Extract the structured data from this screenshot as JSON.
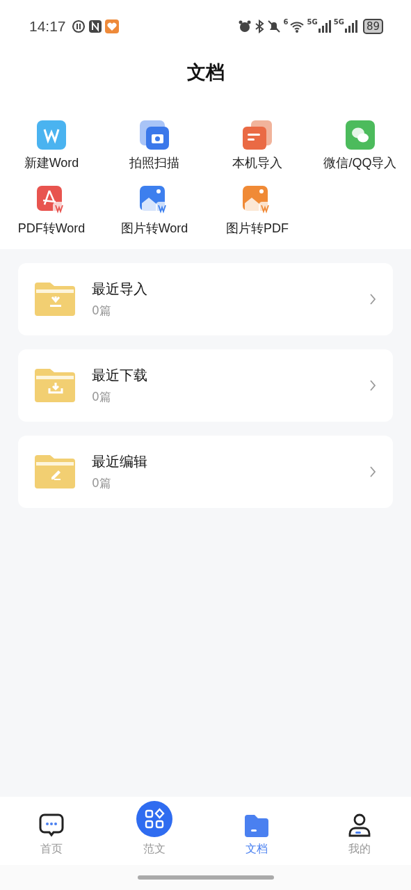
{
  "status_bar": {
    "time": "14:17",
    "wifi_label": "6",
    "networks": [
      "5G",
      "5G"
    ],
    "battery": "89"
  },
  "title": "文档",
  "tools": [
    {
      "label": "新建Word",
      "kind": "word"
    },
    {
      "label": "拍照扫描",
      "kind": "camera"
    },
    {
      "label": "本机导入",
      "kind": "local"
    },
    {
      "label": "微信/QQ导入",
      "kind": "wechat"
    },
    {
      "label": "PDF转Word",
      "kind": "pdf2word"
    },
    {
      "label": "图片转Word",
      "kind": "img2word"
    },
    {
      "label": "图片转PDF",
      "kind": "img2pdf"
    }
  ],
  "folders": [
    {
      "name": "最近导入",
      "count": "0篇",
      "kind": "import"
    },
    {
      "name": "最近下载",
      "count": "0篇",
      "kind": "download"
    },
    {
      "name": "最近编辑",
      "count": "0篇",
      "kind": "edit"
    }
  ],
  "tabs": [
    {
      "label": "首页",
      "kind": "home",
      "selected": false
    },
    {
      "label": "范文",
      "kind": "samples",
      "selected": false
    },
    {
      "label": "文档",
      "kind": "docs",
      "selected": true
    },
    {
      "label": "我的",
      "kind": "me",
      "selected": false
    }
  ]
}
